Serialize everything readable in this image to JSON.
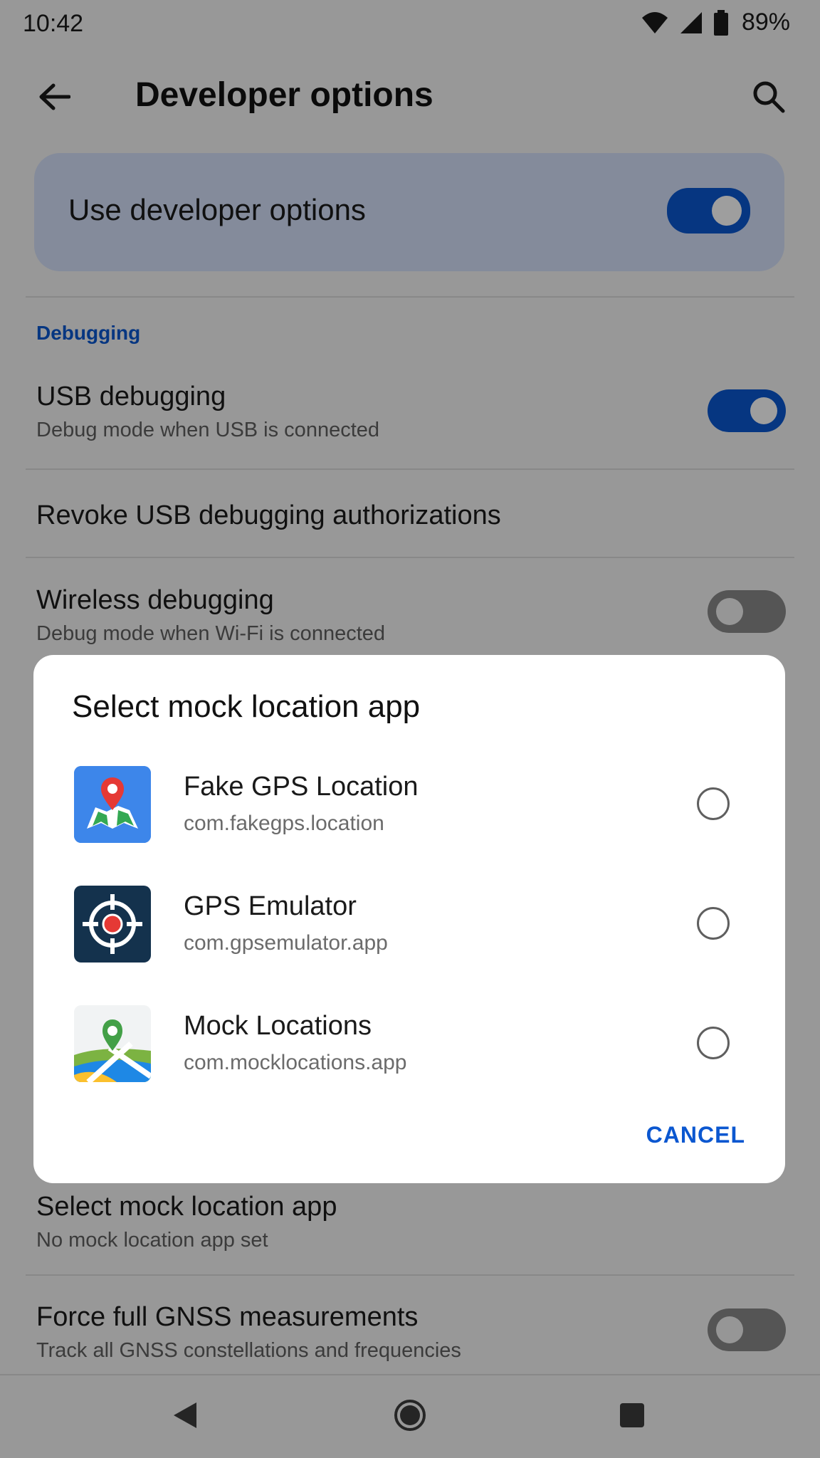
{
  "status_bar": {
    "time": "10:42",
    "battery": "89%"
  },
  "app_bar": {
    "title": "Developer options"
  },
  "master_switch": {
    "label": "Use developer options",
    "on": true
  },
  "section": {
    "title": "Debugging"
  },
  "prefs": {
    "usb_debugging": {
      "title": "USB debugging",
      "summary": "Debug mode when USB is connected",
      "on": true
    },
    "revoke": {
      "title": "Revoke USB debugging authorizations"
    },
    "wireless": {
      "title": "Wireless debugging",
      "summary": "Debug mode when Wi-Fi is connected",
      "on": false
    },
    "mock_location": {
      "title": "Select mock location app",
      "summary": "No mock location app set"
    },
    "gnss": {
      "title": "Force full GNSS measurements",
      "summary": "Track all GNSS constellations and frequencies",
      "on": false
    }
  },
  "dialog": {
    "title": "Select mock location app",
    "options": [
      {
        "name": "Fake GPS Location",
        "package": "com.fakegps.location",
        "icon": "map-pin-icon",
        "selected": false
      },
      {
        "name": "GPS Emulator",
        "package": "com.gpsemulator.app",
        "icon": "crosshair-icon",
        "selected": false
      },
      {
        "name": "Mock Locations",
        "package": "com.mocklocations.app",
        "icon": "map-location-icon",
        "selected": false
      }
    ],
    "cancel_label": "CANCEL"
  },
  "colors": {
    "accent": "#0b57d0",
    "card": "#d5e1fa",
    "scrim": "rgba(0,0,0,0.38)"
  }
}
